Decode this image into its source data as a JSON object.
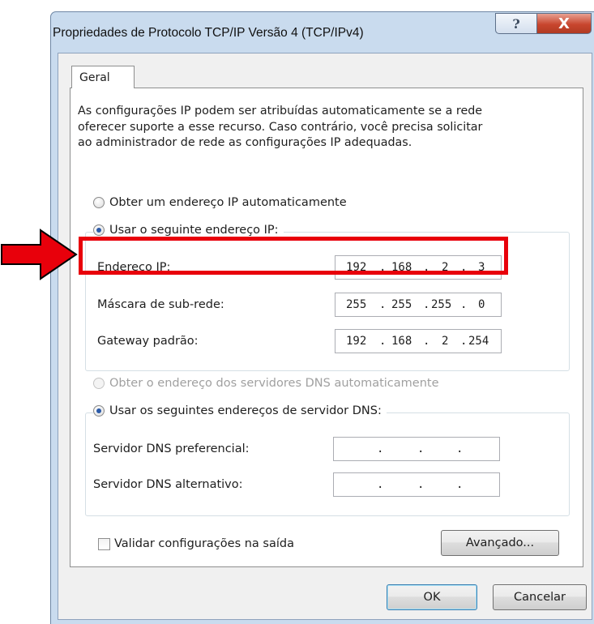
{
  "window": {
    "title": "Propriedades de Protocolo TCP/IP Versão 4 (TCP/IPv4)",
    "help_glyph": "?",
    "close_glyph": "X"
  },
  "tabs": [
    {
      "label": "Geral",
      "selected": true
    }
  ],
  "description": [
    "As configurações IP podem ser atribuídas automaticamente se a rede",
    "oferecer suporte a esse recurso. Caso contrário, você precisa solicitar",
    "ao administrador de rede as configurações IP adequadas."
  ],
  "ip_section": {
    "auto_label": "Obter um endereço IP automaticamente",
    "auto_selected": false,
    "manual_label": "Usar o seguinte endereço IP:",
    "manual_selected": true,
    "fields": [
      {
        "label": "Endereço IP:",
        "octets": [
          "192",
          "168",
          "2",
          "3"
        ]
      },
      {
        "label": "Máscara de sub-rede:",
        "octets": [
          "255",
          "255",
          "255",
          "0"
        ]
      },
      {
        "label": "Gateway padrão:",
        "octets": [
          "192",
          "168",
          "2",
          "254"
        ]
      }
    ]
  },
  "dns_section": {
    "auto_label": "Obter o endereço dos servidores DNS automaticamente",
    "auto_selected": false,
    "auto_disabled": true,
    "manual_label": "Usar os seguintes endereços de servidor DNS:",
    "manual_selected": true,
    "fields": [
      {
        "label": "Servidor DNS preferencial:",
        "octets": [
          "",
          "",
          "",
          ""
        ]
      },
      {
        "label": "Servidor DNS alternativo:",
        "octets": [
          "",
          "",
          "",
          ""
        ]
      }
    ]
  },
  "validate_checkbox": {
    "label": "Validar configurações na saída",
    "checked": false
  },
  "buttons": {
    "advanced": "Avançado...",
    "ok": "OK",
    "cancel": "Cancelar"
  },
  "annotation": {
    "color": "#e8000b",
    "highlighted_field": "Endereço IP:"
  }
}
